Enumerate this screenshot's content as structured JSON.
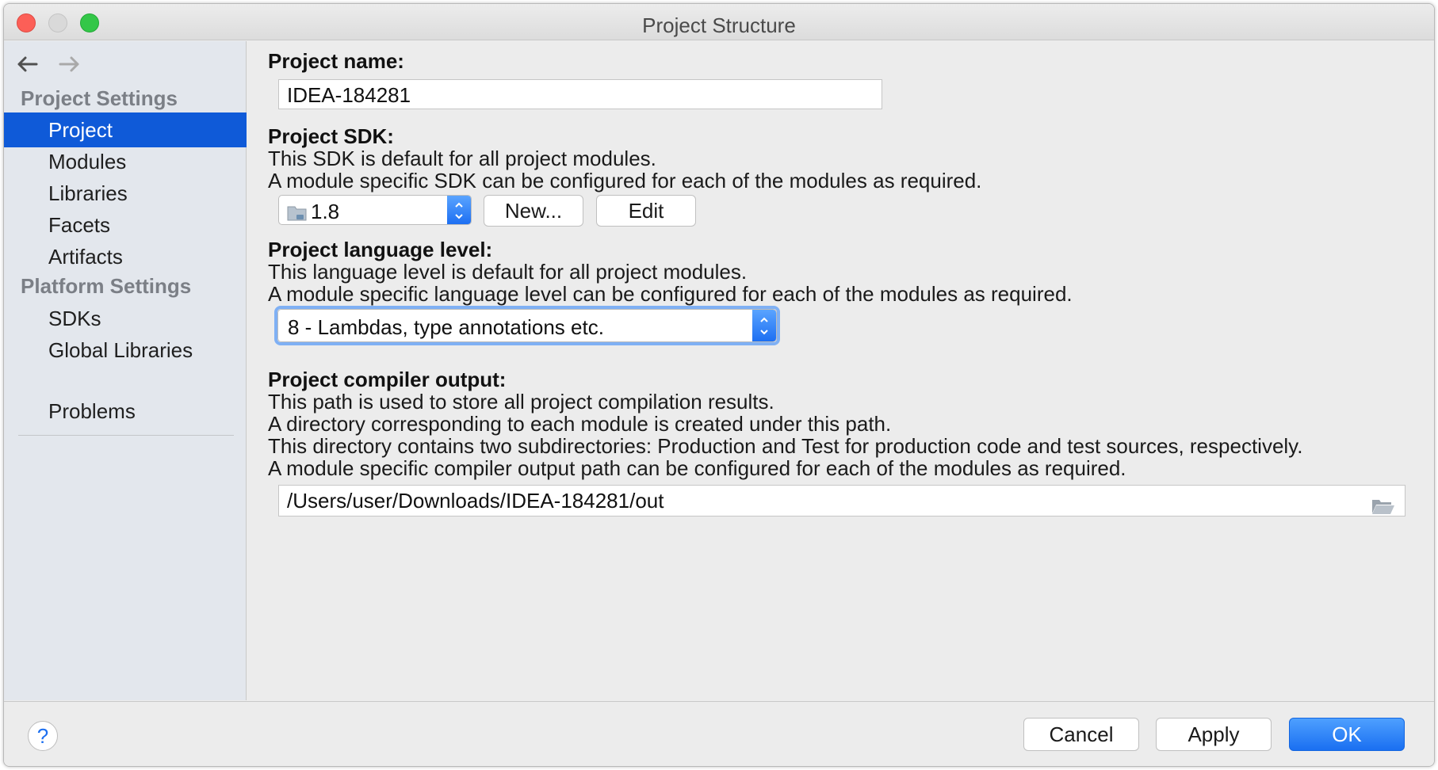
{
  "window": {
    "title": "Project Structure"
  },
  "sidebar": {
    "project_settings_header": "Project Settings",
    "platform_settings_header": "Platform Settings",
    "items": [
      {
        "label": "Project",
        "selected": true
      },
      {
        "label": "Modules"
      },
      {
        "label": "Libraries"
      },
      {
        "label": "Facets"
      },
      {
        "label": "Artifacts"
      },
      {
        "label": "SDKs"
      },
      {
        "label": "Global Libraries"
      },
      {
        "label": "Problems"
      }
    ]
  },
  "project": {
    "name_label": "Project name:",
    "name_value": "IDEA-184281",
    "sdk_label": "Project SDK:",
    "sdk_desc1": "This SDK is default for all project modules.",
    "sdk_desc2": "A module specific SDK can be configured for each of the modules as required.",
    "sdk_value": "1.8",
    "sdk_new_button": "New...",
    "sdk_edit_button": "Edit",
    "lang_label": "Project language level:",
    "lang_desc1": "This language level is default for all project modules.",
    "lang_desc2": "A module specific language level can be configured for each of the modules as required.",
    "lang_value": "8 - Lambdas, type annotations etc.",
    "output_label": "Project compiler output:",
    "output_desc1": "This path is used to store all project compilation results.",
    "output_desc2": "A directory corresponding to each module is created under this path.",
    "output_desc3": "This directory contains two subdirectories: Production and Test for production code and test sources, respectively.",
    "output_desc4": "A module specific compiler output path can be configured for each of the modules as required.",
    "output_value": "/Users/user/Downloads/IDEA-184281/out"
  },
  "footer": {
    "help": "?",
    "cancel": "Cancel",
    "apply": "Apply",
    "ok": "OK"
  },
  "colors": {
    "accent": "#0f5ad8",
    "primary_button": "#1a6ff1",
    "sidebar_bg": "#e3e7ed"
  }
}
